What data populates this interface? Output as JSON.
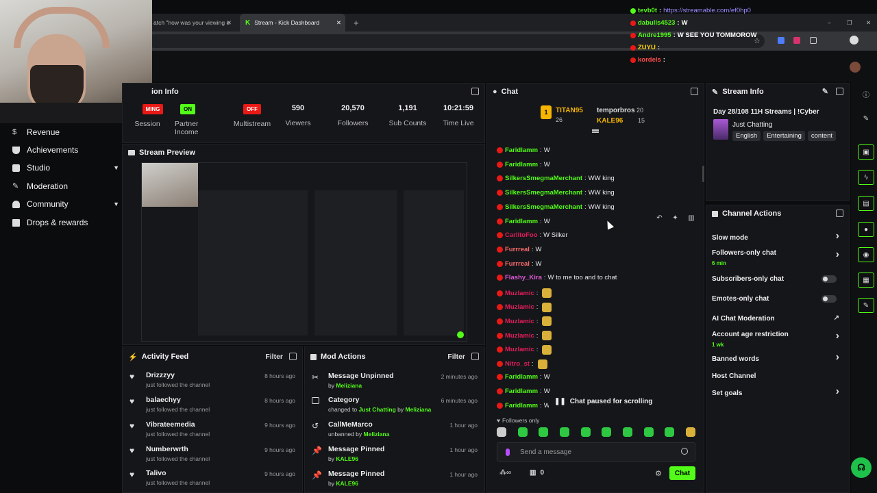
{
  "browser": {
    "tabs": [
      {
        "label": "atch \"how was your viewing e"
      },
      {
        "label": "Stream - Kick Dashboard"
      }
    ],
    "new_tab": "+",
    "window_controls": [
      "–",
      "❐",
      "✕"
    ]
  },
  "sidebar": {
    "items": [
      {
        "label": "Revenue",
        "icon": "dollar-icon"
      },
      {
        "label": "Achievements",
        "icon": "trophy-icon"
      },
      {
        "label": "Studio",
        "icon": "video-icon"
      },
      {
        "label": "Moderation",
        "icon": "wrench-icon"
      },
      {
        "label": "Community",
        "icon": "people-icon"
      },
      {
        "label": "Drops & rewards",
        "icon": "gift-icon"
      }
    ]
  },
  "session_info": {
    "title": "ion Info",
    "stats": [
      {
        "badge": "MING",
        "label": "Session",
        "badge_color": "#e91916"
      },
      {
        "badge": "ON",
        "label": "Partner Income",
        "badge_color": "#53fc18"
      },
      {
        "badge": "OFF",
        "label": "Multistream",
        "badge_color": "#e91916"
      },
      {
        "value": "590",
        "label": "Viewers"
      },
      {
        "value": "20,570",
        "label": "Followers"
      },
      {
        "value": "1,191",
        "label": "Sub Counts"
      },
      {
        "value": "10:21:59",
        "label": "Time Live"
      }
    ]
  },
  "stream_preview": {
    "title": "Stream Preview"
  },
  "activity_feed": {
    "title": "Activity Feed",
    "filter": "Filter",
    "items": [
      {
        "name": "Drizzzyy",
        "sub": "just followed the channel",
        "time": "8 hours ago"
      },
      {
        "name": "balaechyy",
        "sub": "just followed the channel",
        "time": "8 hours ago"
      },
      {
        "name": "Vibrateemedia",
        "sub": "just followed the channel",
        "time": "9 hours ago"
      },
      {
        "name": "Numberwrth",
        "sub": "just followed the channel",
        "time": "9 hours ago"
      },
      {
        "name": "Talivo",
        "sub": "just followed the channel",
        "time": "9 hours ago"
      }
    ]
  },
  "mod_actions": {
    "title": "Mod Actions",
    "filter": "Filter",
    "items": [
      {
        "title": "Message Unpinned",
        "pre": "by",
        "link": "Meliziana",
        "post": "",
        "link2": "",
        "time": "2 minutes ago"
      },
      {
        "title": "Category",
        "pre": "changed to",
        "link": "Just Chatting",
        "post": "by",
        "link2": "Meliziana",
        "time": "6 minutes ago"
      },
      {
        "title": "CallMeMarco",
        "pre": "unbanned by",
        "link": "Meliziana",
        "post": "",
        "link2": "",
        "time": "1 hour ago"
      },
      {
        "title": "Message Pinned",
        "pre": "by",
        "link": "KALE96",
        "post": "",
        "link2": "",
        "time": "1 hour ago"
      },
      {
        "title": "Message Pinned",
        "pre": "by",
        "link": "KALE96",
        "post": "",
        "link2": "",
        "time": "1 hour ago"
      }
    ]
  },
  "chat": {
    "title": "Chat",
    "gifters": [
      {
        "name": "TITAN95",
        "count": "26"
      },
      {
        "name": "temporbros",
        "count": "20"
      },
      {
        "name": "KALE96",
        "count": "15"
      }
    ],
    "messages": [
      {
        "user": "Faridlamm",
        "text": "W",
        "color": "#53fc18"
      },
      {
        "user": "Faridlamm",
        "text": "W",
        "color": "#53fc18"
      },
      {
        "user": "SilkersSmegmaMerchant",
        "text": "WW king",
        "color": "#53fc18"
      },
      {
        "user": "SilkersSmegmaMerchant",
        "text": "WW king",
        "color": "#53fc18"
      },
      {
        "user": "SilkersSmegmaMerchant",
        "text": "WW king",
        "color": "#53fc18"
      },
      {
        "user": "Faridlamm",
        "text": "W",
        "color": "#53fc18"
      },
      {
        "user": "CarlitoFoo",
        "text": "W Silker",
        "color": "#e01e5a"
      },
      {
        "user": "Furrreal",
        "text": "W",
        "color": "#ff6b6b"
      },
      {
        "user": "Furrreal",
        "text": "W",
        "color": "#ff6b6b"
      },
      {
        "user": "Flashy_Kira",
        "text": "W to me too and to chat",
        "color": "#e05ad4"
      },
      {
        "user": "Muzlamic",
        "text": "",
        "color": "#e01e5a"
      },
      {
        "user": "Muzlamic",
        "text": "",
        "color": "#e01e5a"
      },
      {
        "user": "Muzlamic",
        "text": "",
        "color": "#e01e5a"
      },
      {
        "user": "Muzlamic",
        "text": "",
        "color": "#e01e5a"
      },
      {
        "user": "Muzlamic",
        "text": "",
        "color": "#e01e5a"
      },
      {
        "user": "Nitro_st",
        "text": "",
        "color": "#e01e5a"
      },
      {
        "user": "Faridlamm",
        "text": "W",
        "color": "#53fc18"
      },
      {
        "user": "Faridlamm",
        "text": "W",
        "color": "#53fc18"
      },
      {
        "user": "Faridlamm",
        "text": "W",
        "color": "#53fc18"
      }
    ],
    "paused": "Chat paused for scrolling",
    "mode_label": "Followers only",
    "input_placeholder": "Send a message",
    "points": "0",
    "send_label": "Chat"
  },
  "stream_info": {
    "title": "Stream Info",
    "stream_title": "Day 28/108 11H Streams | !Cyber",
    "category": "Just Chatting",
    "tags": [
      "English",
      "Entertaining",
      "content"
    ]
  },
  "channel_actions": {
    "title": "Channel Actions",
    "items": [
      {
        "label": "Slow mode",
        "sub": "",
        "control": "arrow"
      },
      {
        "label": "Followers-only chat",
        "sub": "6 min",
        "control": "arrow"
      },
      {
        "label": "Subscribers-only chat",
        "sub": "",
        "control": "toggle"
      },
      {
        "label": "Emotes-only chat",
        "sub": "",
        "control": "toggle"
      },
      {
        "label": "AI Chat Moderation",
        "sub": "",
        "control": "external"
      },
      {
        "label": "Account age restriction",
        "sub": "1 wk",
        "control": "arrow"
      },
      {
        "label": "Banned words",
        "sub": "",
        "control": "arrow"
      },
      {
        "label": "Host Channel",
        "sub": "",
        "control": "none"
      },
      {
        "label": "Set goals",
        "sub": "",
        "control": "arrow"
      }
    ]
  },
  "overlay_chat": [
    {
      "user": "tevb0t",
      "text": "https://streamable.com/ef0hp0",
      "color": "#53fc18",
      "text_color": "#9b8cff"
    },
    {
      "user": "dabulls4523",
      "text": "W",
      "color": "#53fc18",
      "text_color": "#ffffff"
    },
    {
      "user": "Andre1995",
      "text": "W SEE YOU TOMMOROW",
      "color": "#53fc18",
      "text_color": "#ffffff"
    },
    {
      "user": "ZUYU",
      "text": "",
      "color": "#ffd400",
      "text_color": "#ffffff"
    },
    {
      "user": "kordels",
      "text": "",
      "color": "#ff4d4d",
      "text_color": "#ffffff"
    }
  ],
  "colors": {
    "accent": "#53fc18",
    "live_red": "#e91916",
    "panel": "#15161a"
  }
}
